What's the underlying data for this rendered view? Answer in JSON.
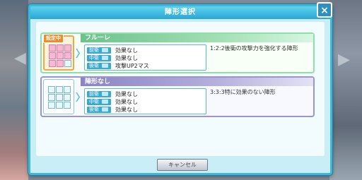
{
  "dialog": {
    "title": "陣形選択",
    "cancel_label": "キャンセル",
    "close_icon": "×"
  },
  "formations": [
    {
      "name": "フルーレ",
      "badge": "設定中",
      "selected": true,
      "rows": [
        {
          "position": "前衛",
          "effect": "効果なし"
        },
        {
          "position": "中衛",
          "effect": "効果なし"
        },
        {
          "position": "後衛",
          "effect": "攻撃UP2マス"
        }
      ],
      "description": "1:2:2後衛の攻撃力を強化する陣形"
    },
    {
      "name": "陣形なし",
      "selected": false,
      "rows": [
        {
          "position": "前衛",
          "effect": "効果なし"
        },
        {
          "position": "中衛",
          "effect": "効果なし"
        },
        {
          "position": "後衛",
          "effect": "効果なし"
        }
      ],
      "description": "3:3:3特に効果のない陣形"
    }
  ]
}
